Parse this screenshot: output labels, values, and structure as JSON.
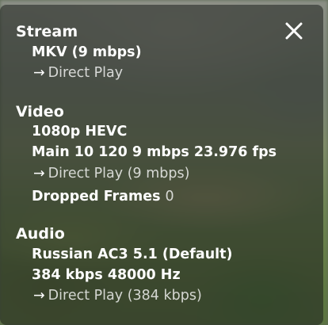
{
  "overlay": {
    "close_icon": "close-icon",
    "stream": {
      "title": "Stream",
      "container": "MKV (9 mbps)",
      "playback": "Direct Play"
    },
    "video": {
      "title": "Video",
      "resolution": "1080p HEVC",
      "details": "Main 10 120 9 mbps 23.976 fps",
      "playback": "Direct Play (9 mbps)",
      "dropped_frames_label": "Dropped Frames",
      "dropped_frames_value": "0"
    },
    "audio": {
      "title": "Audio",
      "track": "Russian AC3 5.1 (Default)",
      "details": "384 kbps 48000 Hz",
      "playback": "Direct Play (384 kbps)"
    },
    "arrow_glyph": "→"
  }
}
